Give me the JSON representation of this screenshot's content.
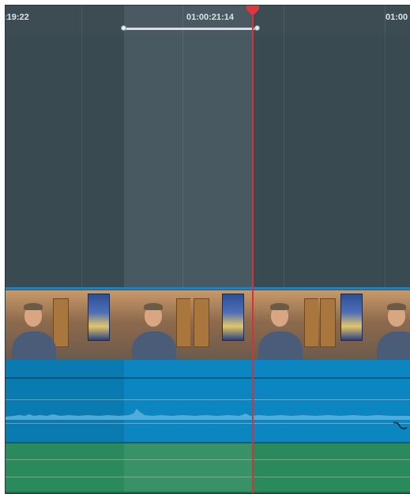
{
  "timeline": {
    "timecodes": {
      "left": ":19:22",
      "center": "01:00:21:14",
      "right": "01:00"
    },
    "colors": {
      "background": "#3a4a51",
      "video_track": "#1e6fa6",
      "audio_track_1": "#0b86c0",
      "audio_track_2": "#2b8a5c",
      "playhead": "#d3343b"
    },
    "icons": [
      "playhead-marker-icon",
      "range-handle-icon",
      "keyframe-curve-icon"
    ]
  }
}
